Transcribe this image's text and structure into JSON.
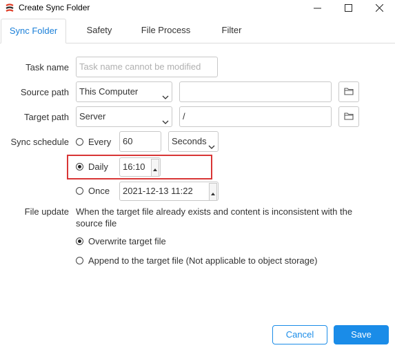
{
  "window": {
    "title": "Create Sync Folder",
    "app_icon": "sync-app-icon",
    "controls": [
      "minimize-icon",
      "maximize-icon",
      "close-icon"
    ]
  },
  "tabs": [
    {
      "label": "Sync Folder",
      "active": true
    },
    {
      "label": "Safety",
      "active": false
    },
    {
      "label": "File Process",
      "active": false
    },
    {
      "label": "Filter",
      "active": false
    }
  ],
  "form": {
    "task_name": {
      "label": "Task name",
      "placeholder": "Task name cannot be modified",
      "value": ""
    },
    "source_path": {
      "label": "Source path",
      "select_value": "This Computer",
      "path_value": "",
      "browse_icon": "folder-icon"
    },
    "target_path": {
      "label": "Target path",
      "select_value": "Server",
      "path_value": "/",
      "browse_icon": "folder-icon"
    },
    "sync_schedule": {
      "label": "Sync schedule",
      "every": {
        "label": "Every",
        "value": "60",
        "unit": "Seconds",
        "checked": false
      },
      "daily": {
        "label": "Daily",
        "value": "16:10",
        "checked": true
      },
      "once": {
        "label": "Once",
        "value": "2021-12-13 11:22",
        "checked": false
      }
    },
    "file_update": {
      "label": "File update",
      "description": "When the target file already exists and content is inconsistent with the source file",
      "options": [
        {
          "label": "Overwrite target file",
          "checked": true
        },
        {
          "label": "Append to the target file (Not applicable to object storage)",
          "checked": false
        }
      ]
    }
  },
  "footer": {
    "cancel_label": "Cancel",
    "save_label": "Save"
  },
  "colors": {
    "accent": "#1a8ce8",
    "highlight": "#d83535",
    "active_tab_text": "#1a7fd8"
  }
}
